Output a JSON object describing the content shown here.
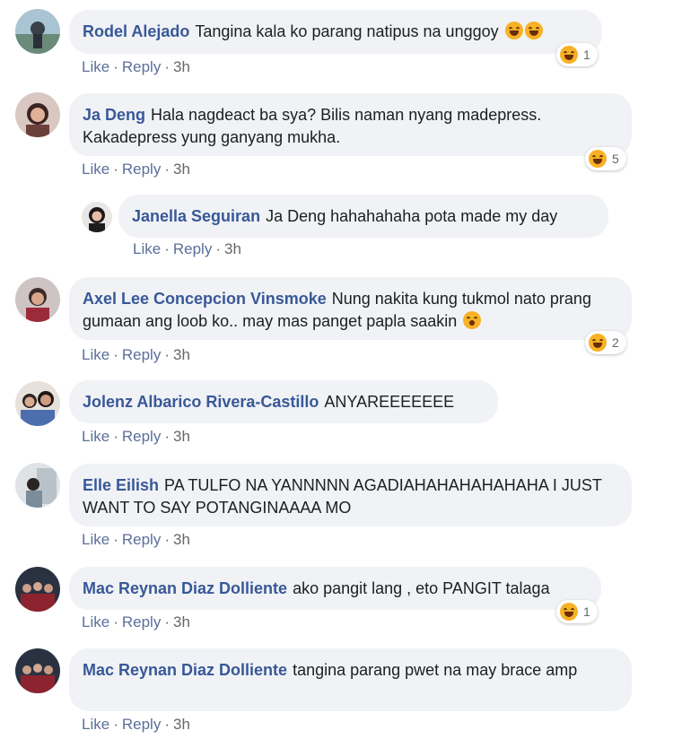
{
  "labels": {
    "like": "Like",
    "reply": "Reply",
    "dot": "·"
  },
  "comments": [
    {
      "author": "Rodel Alejado",
      "text": "Tangina kala ko parang natipus na unggoy",
      "time": "3h",
      "reaction_count": "1"
    },
    {
      "author": "Ja Deng",
      "text": "Hala nagdeact ba sya? Bilis naman nyang madepress. Kakadepress yung ganyang mukha.",
      "time": "3h",
      "reaction_count": "5"
    },
    {
      "author": "Janella Seguiran",
      "text": "Ja Deng hahahahaha pota made my day",
      "time": "3h"
    },
    {
      "author": "Axel Lee Concepcion Vinsmoke",
      "text": "Nung nakita kung tukmol nato prang gumaan ang loob ko.. may mas panget papla saakin",
      "time": "3h",
      "reaction_count": "2"
    },
    {
      "author": "Jolenz Albarico Rivera-Castillo",
      "text": "ANYAREEEEEEE",
      "time": "3h"
    },
    {
      "author": "Elle Eilish",
      "text": "PA TULFO NA YANNNNN AGADIAHAHAHAHAHAHA I JUST WANT TO SAY POTANGINAAAA MO",
      "time": "3h"
    },
    {
      "author": "Mac Reynan Diaz Dolliente",
      "text": "ako pangit lang , eto PANGIT talaga",
      "time": "3h",
      "reaction_count": "1"
    },
    {
      "author": "Mac Reynan Diaz Dolliente",
      "text": "tangina parang pwet na may brace amp",
      "time": "3h"
    }
  ],
  "colors": {
    "author": "#385898",
    "bubble": "#f0f2f5",
    "action": "#5b6f9a",
    "emoji": "#f7b125"
  },
  "icons": {
    "reaction": "haha-emoji-icon",
    "inline_laugh": "tears-of-joy-emoji-icon",
    "inline_shock": "shocked-emoji-icon"
  }
}
